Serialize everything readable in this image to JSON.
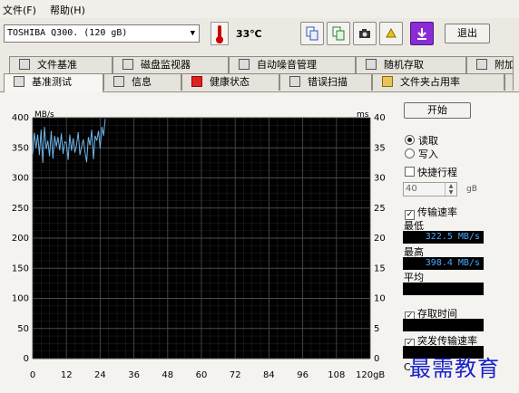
{
  "menu": {
    "file": "文件(F)",
    "help": "帮助(H)"
  },
  "toolbar": {
    "drive": "TOSHIBA Q300. (120 gB)",
    "temperature": "33℃",
    "exit_label": "退出",
    "icons": [
      "copy-text-icon",
      "copy-screen-icon",
      "camera-icon",
      "health-icon",
      "download-icon"
    ]
  },
  "tabs_back": [
    {
      "label": "文件基准",
      "icon": "file-benchmark-icon"
    },
    {
      "label": "磁盘监视器",
      "icon": "disk-monitor-icon"
    },
    {
      "label": "自动噪音管理",
      "icon": "speaker-icon"
    },
    {
      "label": "随机存取",
      "icon": "random-access-icon"
    },
    {
      "label": "附加",
      "icon": "extra-icon"
    }
  ],
  "tabs_front": [
    {
      "label": "基准测试",
      "icon": "benchmark-icon"
    },
    {
      "label": "信息",
      "icon": "info-icon"
    },
    {
      "label": "健康状态",
      "icon": "health-cross-icon"
    },
    {
      "label": "错误扫描",
      "icon": "magnifier-icon"
    },
    {
      "label": "文件夹占用率",
      "icon": "folder-icon"
    }
  ],
  "colors": {
    "chart_bg": "#000000",
    "grid": "#4a4a4a",
    "series": "#6fb4e8",
    "stat_text": "#4aa8ff",
    "watermark": "#1a22c8"
  },
  "chart_data": {
    "type": "line",
    "left_unit": "MB/s",
    "right_unit": "ms",
    "ylim_left": [
      0,
      400
    ],
    "ylim_right": [
      0,
      40
    ],
    "y_ticks_left": [
      "0",
      "50",
      "100",
      "150",
      "200",
      "250",
      "300",
      "350",
      "400"
    ],
    "y_ticks_right": [
      "0",
      "5",
      "10",
      "15",
      "20",
      "25",
      "30",
      "35",
      "40"
    ],
    "xlim": [
      0,
      120
    ],
    "x_ticks": [
      "0",
      "12",
      "24",
      "36",
      "48",
      "60",
      "72",
      "84",
      "96",
      "108",
      "120gB"
    ],
    "series": [
      {
        "x": [
          0,
          0.6,
          1.2,
          1.8,
          2.4,
          3,
          3.6,
          4.2,
          4.8,
          5.4,
          6,
          6.6,
          7.2,
          7.8,
          8.4,
          9,
          9.6,
          10.2,
          10.8,
          11.4,
          12,
          12.6,
          13.2,
          13.8,
          14.4,
          15,
          15.6,
          16.2,
          16.8,
          17.4,
          18,
          18.6,
          19.2,
          19.8,
          20.4,
          21,
          21.6,
          22.2,
          22.8,
          23.4,
          24,
          24.6,
          25.2,
          25.8
        ],
        "y": [
          340,
          375,
          350,
          372,
          338,
          380,
          325,
          385,
          348,
          362,
          336,
          378,
          332,
          370,
          352,
          368,
          346,
          374,
          340,
          360,
          358,
          330,
          372,
          345,
          366,
          342,
          355,
          376,
          338,
          352,
          364,
          343,
          326,
          368,
          354,
          380,
          331,
          370,
          362,
          378,
          349,
          385,
          370,
          398
        ]
      }
    ]
  },
  "controls": {
    "start_label": "开始",
    "read_label": "读取",
    "write_label": "写入",
    "shortstroke_label": "快捷行程",
    "shortstroke_value": "40",
    "shortstroke_unit": "gB",
    "transfer_label": "传输速率",
    "min_label": "最低",
    "min_value": "322.5 MB/s",
    "max_label": "最高",
    "max_value": "398.4 MB/s",
    "avg_label": "平均",
    "access_label": "存取时间",
    "burst_label": "突发传输速率",
    "cpu_label": "C"
  },
  "watermark": "最需教育"
}
